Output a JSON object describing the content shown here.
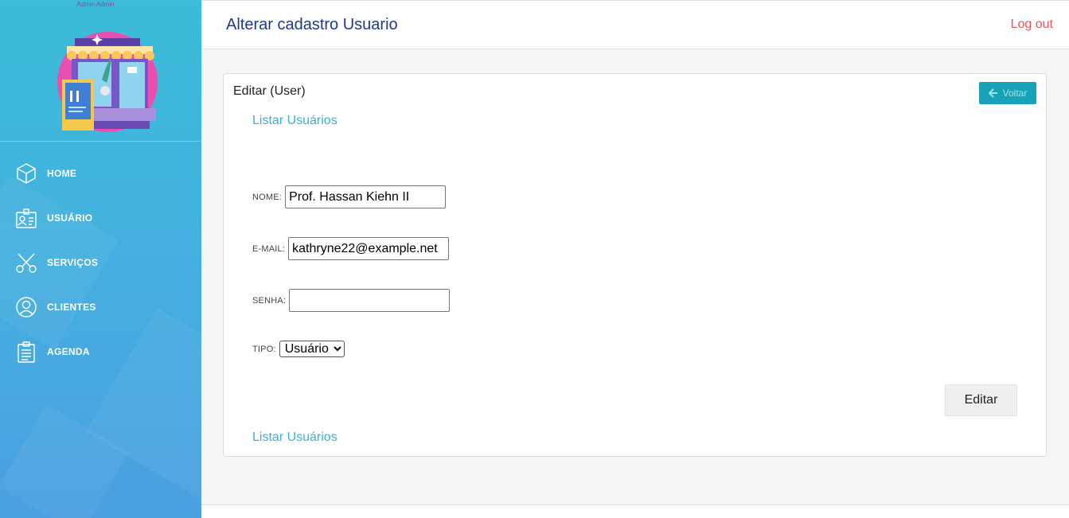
{
  "sidebar": {
    "user_name": "Admin Admin",
    "items": [
      {
        "label": "HOME",
        "icon": "cube-icon"
      },
      {
        "label": "USUÁRIO",
        "icon": "id-card-icon"
      },
      {
        "label": "SERVIÇOS",
        "icon": "scissors-icon"
      },
      {
        "label": "CLIENTES",
        "icon": "user-circle-icon"
      },
      {
        "label": "AGENDA",
        "icon": "clipboard-icon"
      }
    ]
  },
  "header": {
    "title": "Alterar cadastro Usuario",
    "logout_label": "Log out"
  },
  "card": {
    "title": "Editar (User)",
    "back_label": "Voltar",
    "list_link_top": "Listar Usuários",
    "list_link_bottom": "Listar Usuários",
    "form": {
      "nome_label": "NOME:",
      "nome_value": "Prof. Hassan Kiehn II",
      "email_label": "E-MAIL:",
      "email_value": "kathryne22@example.net",
      "senha_label": "SENHA:",
      "senha_value": "",
      "tipo_label": "TIPO:",
      "tipo_selected": "Usuário",
      "submit_label": "Editar"
    }
  },
  "colors": {
    "accent_blue": "#3aaed8",
    "title_blue": "#1e3a8a",
    "logout_red": "#e8545e",
    "button_teal": "#17a2b8"
  }
}
